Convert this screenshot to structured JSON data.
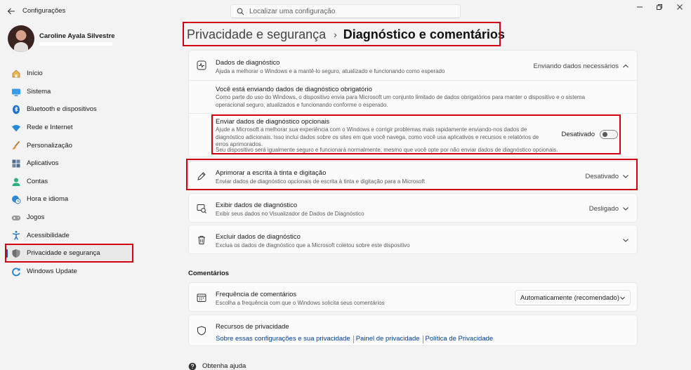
{
  "app": {
    "title": "Configurações",
    "search_placeholder": "Localizar uma configuração"
  },
  "user": {
    "name": "Caroline Ayala Silvestre"
  },
  "sidebar": {
    "items": [
      {
        "label": "Início",
        "icon": "home-icon",
        "color": "#c29a3f"
      },
      {
        "label": "Sistema",
        "icon": "monitor-icon",
        "color": "#1a82d6"
      },
      {
        "label": "Bluetooth e dispositivos",
        "icon": "bluetooth-icon",
        "color": "#1a6fd0"
      },
      {
        "label": "Rede e Internet",
        "icon": "wifi-icon",
        "color": "#2a8ad8"
      },
      {
        "label": "Personalização",
        "icon": "brush-icon",
        "color": "#d67b2a"
      },
      {
        "label": "Aplicativos",
        "icon": "apps-icon",
        "color": "#4f6b8a"
      },
      {
        "label": "Contas",
        "icon": "person-icon",
        "color": "#2fae7e"
      },
      {
        "label": "Hora e idioma",
        "icon": "clock-globe-icon",
        "color": "#2a8ad8"
      },
      {
        "label": "Jogos",
        "icon": "gamepad-icon",
        "color": "#8a8a8a"
      },
      {
        "label": "Acessibilidade",
        "icon": "accessibility-icon",
        "color": "#1a6fd0"
      },
      {
        "label": "Privacidade e segurança",
        "icon": "shield-icon",
        "color": "#7a7a7a"
      },
      {
        "label": "Windows Update",
        "icon": "update-icon",
        "color": "#1a82d6"
      }
    ],
    "active_index": 10
  },
  "breadcrumb": {
    "parent": "Privacidade e segurança",
    "separator": "›",
    "current": "Diagnóstico e comentários"
  },
  "diagnostic": {
    "title": "Dados de diagnóstico",
    "desc": "Ajuda a melhorar o Windows e a mantê-lo seguro, atualizado e funcionando como esperado",
    "status": "Enviando dados necessários",
    "required": {
      "title": "Você está enviando dados de diagnóstico obrigatório",
      "desc": "Como parte do uso do Windows, o dispositivo envia para Microsoft um conjunto limitado de dados obrigatórios para manter o dispositivo e o sistema operacional seguro, atualizados e funcionando conforme o esperado."
    },
    "optional": {
      "title": "Enviar dados de diagnóstico opcionais",
      "desc": "Ajude a Microsoft a melhorar sua experiência com o Windows e corrigir problemas mais rapidamente enviando-nos dados de diagnóstico adicionais. Isso inclui dados sobre os sites em que você navega, como você usa aplicativos e recursos e relatórios de erros aprimorados.",
      "note": "Seu dispositivo será igualmente seguro e funcionará normalmente, mesmo que você opte por não enviar dados de diagnóstico opcionais.",
      "toggle_label": "Desativado",
      "toggle_on": false
    }
  },
  "inking": {
    "title": "Aprimorar a escrita à tinta e digitação",
    "desc": "Enviar dados de diagnóstico opcionais de escrita à tinta e digitação para a Microsoft",
    "status": "Desativado"
  },
  "view_data": {
    "title": "Exibir dados de diagnóstico",
    "desc": "Exibir seus dados no Visualizador de Dados de Diagnóstico",
    "status": "Desligado"
  },
  "delete_data": {
    "title": "Excluir dados de diagnóstico",
    "desc": "Exclua os dados de diagnóstico que a Microsoft coletou sobre este dispositivo"
  },
  "feedback": {
    "section": "Comentários",
    "frequency": {
      "title": "Frequência de comentários",
      "desc": "Escolha a frequência com que o Windows solicita seus comentários",
      "value": "Automaticamente (recomendado)"
    },
    "privacy": {
      "title": "Recursos de privacidade",
      "links": [
        "Sobre essas configurações e sua privacidade",
        "Painel de privacidade",
        "Política de Privacidade"
      ]
    }
  },
  "help": {
    "label": "Obtenha ajuda"
  },
  "colors": {
    "accent": "#005fb8",
    "link": "#003e92",
    "highlight_box": "#d00012"
  }
}
